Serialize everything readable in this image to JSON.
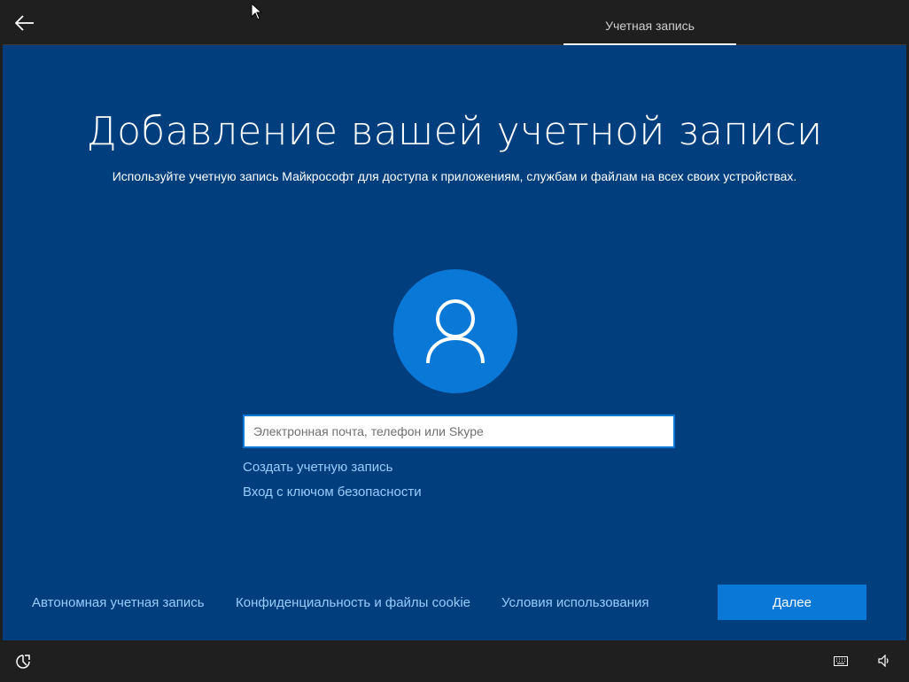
{
  "header": {
    "back_icon": "arrow-left-icon",
    "tab_label": "Учетная запись"
  },
  "main": {
    "title": "Добавление вашей учетной записи",
    "subtitle": "Используйте учетную запись Майкрософт для доступа к приложениям, службам и файлам на всех своих устройствах.",
    "avatar_icon": "user-icon",
    "email_input": {
      "value": "",
      "placeholder": "Электронная почта, телефон или Skype"
    },
    "create_account_link": "Создать учетную запись",
    "security_key_link": "Вход с ключом безопасности"
  },
  "footer": {
    "offline_account": "Автономная учетная запись",
    "privacy_cookies": "Конфиденциальность и файлы cookie",
    "terms_of_use": "Условия использования",
    "next_button": "Далее"
  },
  "taskbar": {
    "ease_of_access_icon": "ease-of-access-icon",
    "keyboard_icon": "keyboard-icon",
    "volume_icon": "volume-icon"
  },
  "colors": {
    "main_background": "#003e7d",
    "accent": "#0a78d6",
    "link": "#99ccff",
    "bar_background": "#1f1f1f"
  }
}
